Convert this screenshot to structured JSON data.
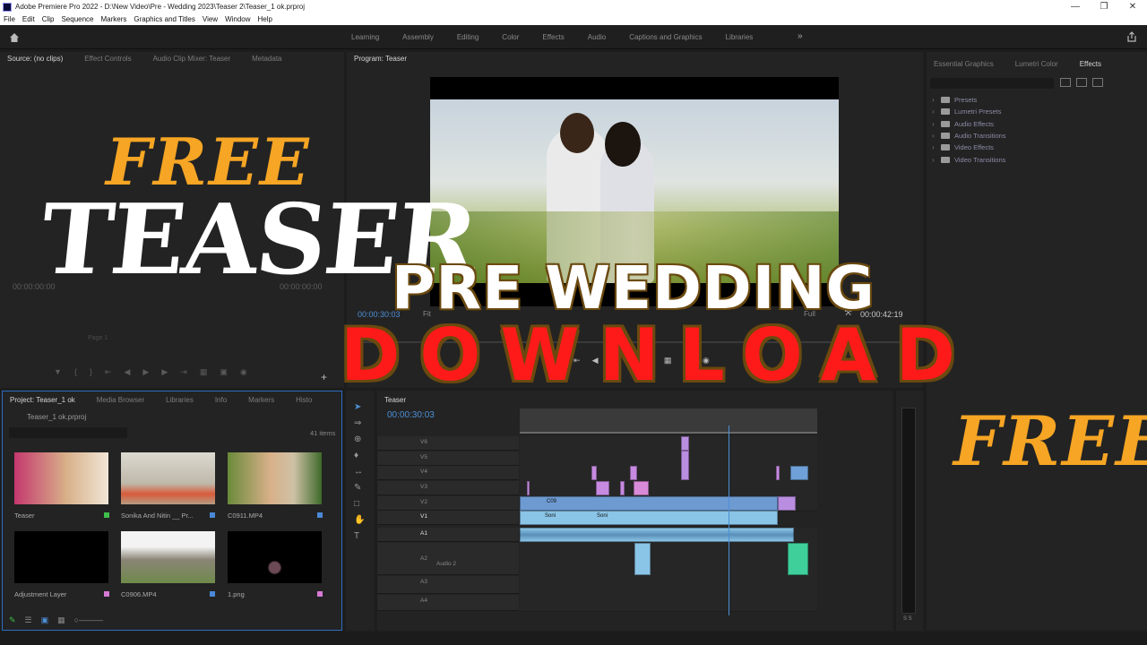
{
  "window": {
    "title": "Adobe Premiere Pro 2022 - D:\\New Video\\Pre - Wedding 2023\\Teaser 2\\Teaser_1 ok.prproj"
  },
  "menu": [
    "File",
    "Edit",
    "Clip",
    "Sequence",
    "Markers",
    "Graphics and Titles",
    "View",
    "Window",
    "Help"
  ],
  "workspaces": [
    "Learning",
    "Assembly",
    "Editing",
    "Color",
    "Effects",
    "Audio",
    "Captions and Graphics",
    "Libraries"
  ],
  "workspace_more": "»",
  "source_panel": {
    "tabs": [
      "Source: (no clips)",
      "Effect Controls",
      "Audio Clip Mixer: Teaser",
      "Metadata"
    ],
    "tc_left": "00:00:00:00",
    "page": "Page 1",
    "tc_right": "00:00:00:00"
  },
  "program_panel": {
    "tab": "Program: Teaser",
    "tc_current": "00:00:30:03",
    "fit": "Fit",
    "quality": "Full",
    "tc_duration": "00:00:42:19"
  },
  "effects_panel": {
    "tabs": [
      "Essential Graphics",
      "Lumetri Color",
      "Effects"
    ],
    "items": [
      "Presets",
      "Lumetri Presets",
      "Audio Effects",
      "Audio Transitions",
      "Video Effects",
      "Video Transitions"
    ]
  },
  "project_panel": {
    "tabs": [
      "Project: Teaser_1 ok",
      "Media Browser",
      "Libraries",
      "Info",
      "Markers",
      "Histo"
    ],
    "path": "Teaser_1 ok.prproj",
    "count": "41 items",
    "items": [
      {
        "label": "Teaser",
        "badge": "#3fbf4a"
      },
      {
        "label": "Sonika And Nitin __ Pr...",
        "badge": "#4a88d6"
      },
      {
        "label": "C0911.MP4",
        "badge": "#4a88d6"
      },
      {
        "label": "Adjustment Layer",
        "badge": "#d67ad6"
      },
      {
        "label": "C0906.MP4",
        "badge": "#4a88d6"
      },
      {
        "label": "1.png",
        "badge": "#d67ad6"
      }
    ]
  },
  "timeline": {
    "tab": "Teaser",
    "tc": "00:00:30:03",
    "video_tracks": [
      "V6",
      "V5",
      "V4",
      "V3",
      "V2",
      "V1"
    ],
    "audio_tracks": [
      "A1",
      "A2",
      "A3",
      "A4"
    ],
    "audio2_name": "Audio 2",
    "clip_labels": [
      "C09",
      "Soni",
      "Soni"
    ],
    "meter_scale": "S S"
  },
  "overlay": {
    "free_top": "FREE",
    "teaser": "TEASER",
    "pre_wedding": "PRE WEDDING",
    "download": "DOWNLOAD",
    "free_right": "FREE"
  },
  "colors": {
    "accent": "#4d8fd6",
    "overlay_orange": "#f6a524",
    "overlay_red": "#ff1a1a"
  }
}
